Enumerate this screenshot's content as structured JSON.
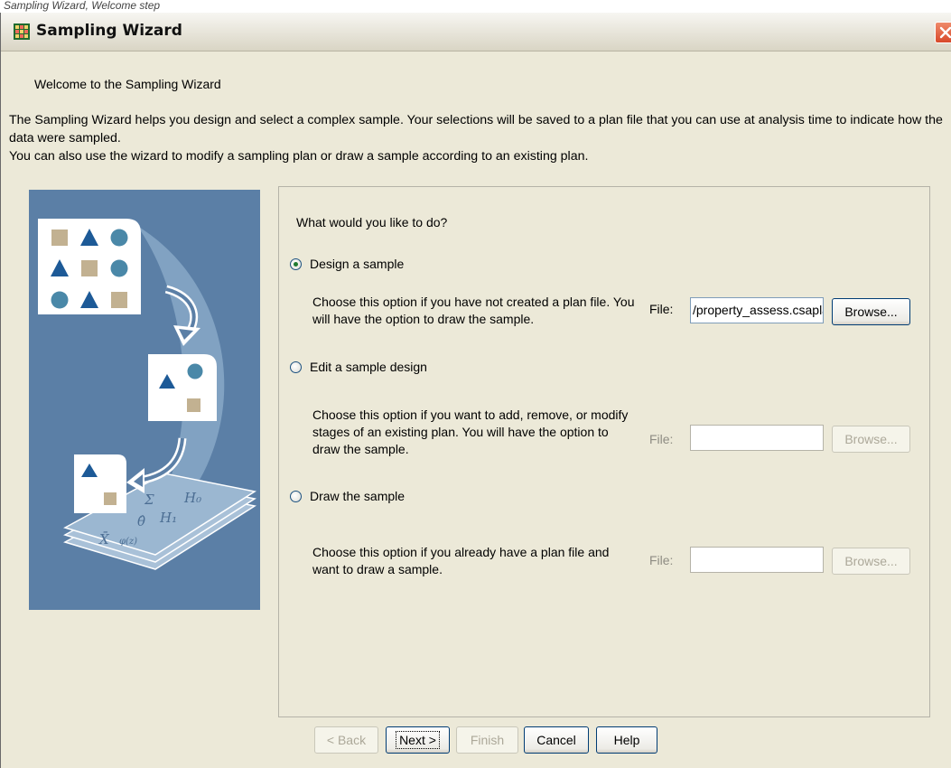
{
  "caption": "Sampling Wizard, Welcome step",
  "window": {
    "title": "Sampling Wizard"
  },
  "welcome": "Welcome to the Sampling Wizard",
  "intro": {
    "line1": "The Sampling Wizard helps you design and select a complex sample. Your selections will be saved to a plan file that you can use at analysis time to indicate how the data were sampled.",
    "line2": "You can also use the wizard to modify a sampling plan or draw a sample according to an existing plan."
  },
  "illustration": {
    "formula_sigma": "Σ",
    "formula_h0": "H₀",
    "formula_theta": "θ̂",
    "formula_h1": "H₁",
    "formula_xbar": "X̄",
    "formula_phi": "φ(z)"
  },
  "question": "What would you like to do?",
  "options": [
    {
      "label": "Design a sample",
      "checked": true,
      "description": "Choose this option if you have not created a plan file. You will have the option to draw the sample.",
      "file_label": "File:",
      "file_value": "/property_assess.csaplan",
      "browse_label": "Browse...",
      "enabled": true
    },
    {
      "label": "Edit a sample design",
      "checked": false,
      "description": "Choose this option if you want to add, remove, or modify stages of an existing plan. You will have the option to draw the sample.",
      "file_label": "File:",
      "file_value": "",
      "browse_label": "Browse...",
      "enabled": false
    },
    {
      "label": "Draw the sample",
      "checked": false,
      "description": "Choose this option if you already have a plan file and want to draw a sample.",
      "file_label": "File:",
      "file_value": "",
      "browse_label": "Browse...",
      "enabled": false
    }
  ],
  "buttons": {
    "back": "< Back",
    "next": "Next >",
    "finish": "Finish",
    "cancel": "Cancel",
    "help": "Help"
  },
  "colors": {
    "window_bg": "#ece9d8",
    "illustration_bg": "#5b7fa6",
    "accent_blue": "#1d5a97",
    "tan_square": "#c2b191",
    "teal_circle": "#4a88a8"
  }
}
